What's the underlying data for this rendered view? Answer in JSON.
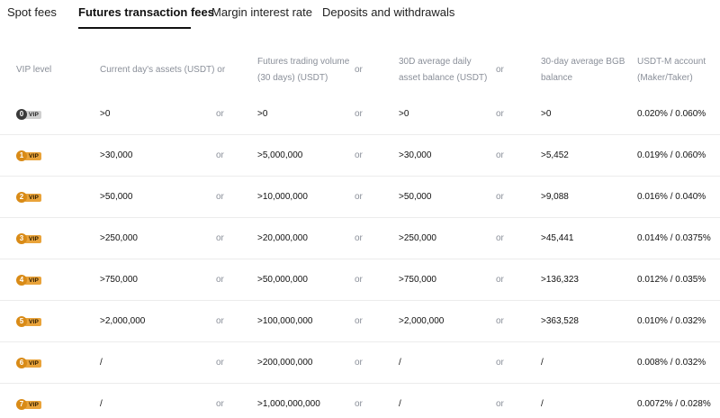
{
  "tabs": [
    {
      "label": "Spot fees",
      "active": false
    },
    {
      "label": "Futures transaction fees",
      "active": true
    },
    {
      "label": "Margin interest rate",
      "active": false
    },
    {
      "label": "Deposits and withdrawals",
      "active": false
    }
  ],
  "headers": {
    "vip_level": "VIP level",
    "assets": "Current day's assets (USDT) or",
    "volume_line1": "Futures trading volume",
    "volume_line2": "(30 days) (USDT)",
    "or": "or",
    "balance_line1": "30D average daily",
    "balance_line2": "asset balance (USDT)",
    "bgb_line1": "30-day average BGB",
    "bgb_line2": "balance",
    "fee_line1": "USDT-M account",
    "fee_line2": "(Maker/Taker)"
  },
  "vip_tag": "VIP",
  "or_text": "or",
  "rows": [
    {
      "level": "0",
      "assets": ">0",
      "volume": ">0",
      "balance": ">0",
      "bgb": ">0",
      "fee": "0.020% / 0.060%"
    },
    {
      "level": "1",
      "assets": ">30,000",
      "volume": ">5,000,000",
      "balance": ">30,000",
      "bgb": ">5,452",
      "fee": "0.019% / 0.060%"
    },
    {
      "level": "2",
      "assets": ">50,000",
      "volume": ">10,000,000",
      "balance": ">50,000",
      "bgb": ">9,088",
      "fee": "0.016% / 0.040%"
    },
    {
      "level": "3",
      "assets": ">250,000",
      "volume": ">20,000,000",
      "balance": ">250,000",
      "bgb": ">45,441",
      "fee": "0.014% / 0.0375%"
    },
    {
      "level": "4",
      "assets": ">750,000",
      "volume": ">50,000,000",
      "balance": ">750,000",
      "bgb": ">136,323",
      "fee": "0.012% / 0.035%"
    },
    {
      "level": "5",
      "assets": ">2,000,000",
      "volume": ">100,000,000",
      "balance": ">2,000,000",
      "bgb": ">363,528",
      "fee": "0.010% / 0.032%"
    },
    {
      "level": "6",
      "assets": "/",
      "volume": ">200,000,000",
      "balance": "/",
      "bgb": "/",
      "fee": "0.008% / 0.032%"
    },
    {
      "level": "7",
      "assets": "/",
      "volume": ">1,000,000,000",
      "balance": "/",
      "bgb": "/",
      "fee": "0.0072% / 0.028%"
    }
  ]
}
